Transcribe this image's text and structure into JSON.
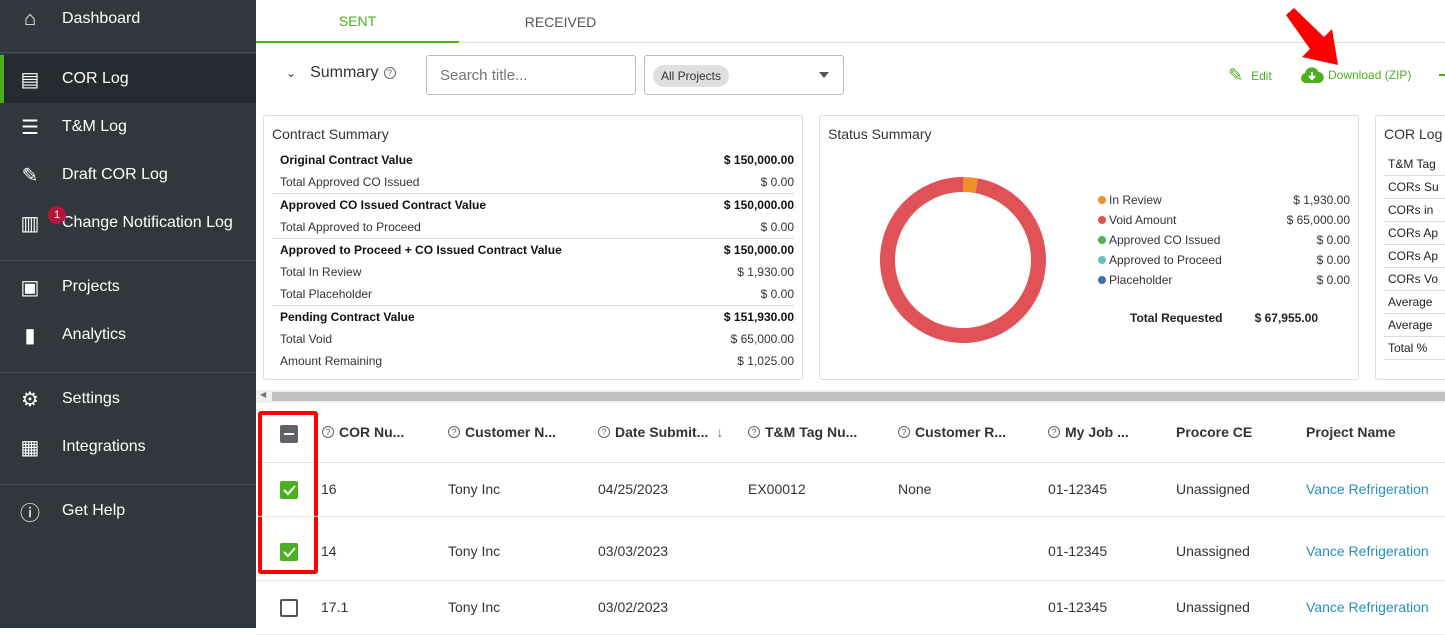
{
  "sidebar": {
    "items": [
      {
        "label": "Dashboard",
        "icon": "home-icon"
      },
      {
        "label": "COR Log",
        "icon": "document-icon",
        "active": true
      },
      {
        "label": "T&M Log",
        "icon": "list-icon"
      },
      {
        "label": "Draft COR Log",
        "icon": "pencil-icon"
      },
      {
        "label": "Change Notification Log",
        "icon": "clipboard-icon",
        "badge": "1"
      },
      {
        "label": "Projects",
        "icon": "briefcase-icon"
      },
      {
        "label": "Analytics",
        "icon": "bar-chart-icon"
      },
      {
        "label": "Settings",
        "icon": "gear-icon"
      },
      {
        "label": "Integrations",
        "icon": "grid-icon"
      },
      {
        "label": "Get Help",
        "icon": "help-icon"
      }
    ]
  },
  "tabs": [
    {
      "label": "SENT",
      "active": true
    },
    {
      "label": "RECEIVED"
    }
  ],
  "toolbar": {
    "summary_label": "Summary",
    "search_placeholder": "Search title...",
    "project_filter": "All Projects",
    "edit_label": "Edit",
    "download_label": "Download (ZIP)"
  },
  "contract_summary": {
    "title": "Contract Summary",
    "rows": [
      {
        "label": "Original Contract Value",
        "value": "$ 150,000.00",
        "bold": true
      },
      {
        "label": "Total Approved CO Issued",
        "value": "$ 0.00"
      },
      {
        "label": "Approved CO Issued Contract Value",
        "value": "$ 150,000.00",
        "bold": true
      },
      {
        "label": "Total Approved to Proceed",
        "value": "$ 0.00"
      },
      {
        "label": "Approved to Proceed + CO Issued Contract Value",
        "value": "$ 150,000.00",
        "bold": true
      },
      {
        "label": "Total In Review",
        "value": "$ 1,930.00"
      },
      {
        "label": "Total Placeholder",
        "value": "$ 0.00"
      },
      {
        "label": "Pending Contract Value",
        "value": "$ 151,930.00",
        "bold": true
      },
      {
        "label": "Total Void",
        "value": "$ 65,000.00"
      },
      {
        "label": "Amount Remaining",
        "value": "$ 1,025.00"
      }
    ]
  },
  "status_summary": {
    "title": "Status Summary",
    "legend": [
      {
        "label": "In Review",
        "value": "$ 1,930.00",
        "amount": 1930,
        "color": "#f0902a"
      },
      {
        "label": "Void Amount",
        "value": "$ 65,000.00",
        "amount": 65000,
        "color": "#e05256"
      },
      {
        "label": "Approved CO Issued",
        "value": "$ 0.00",
        "amount": 0,
        "color": "#4caf50"
      },
      {
        "label": "Approved to Proceed",
        "value": "$ 0.00",
        "amount": 0,
        "color": "#6bbfbf"
      },
      {
        "label": "Placeholder",
        "value": "$ 0.00",
        "amount": 0,
        "color": "#3f6ea8"
      }
    ],
    "total_label": "Total Requested",
    "total_value": "$ 67,955.00"
  },
  "cor_log": {
    "title": "COR Log C",
    "rows": [
      "T&M Tag",
      "CORs Su",
      "CORs in",
      "CORs Ap",
      "CORs Ap",
      "CORs Vo",
      "Average",
      "Average",
      "Total %"
    ]
  },
  "table": {
    "columns": [
      "COR Nu...",
      "Customer N...",
      "Date Submit...",
      "T&M Tag Nu...",
      "Customer R...",
      "My Job ...",
      "Procore CE",
      "Project Name"
    ],
    "rows": [
      {
        "checked": true,
        "cells": [
          "16",
          "Tony Inc",
          "04/25/2023",
          "EX00012",
          "None",
          "01-12345",
          "Unassigned",
          "Vance Refrigeration"
        ]
      },
      {
        "checked": true,
        "cells": [
          "14",
          "Tony Inc",
          "03/03/2023",
          "",
          "",
          "01-12345",
          "Unassigned",
          "Vance Refrigeration"
        ]
      },
      {
        "checked": false,
        "cells": [
          "17.1",
          "Tony Inc",
          "03/02/2023",
          "",
          "",
          "01-12345",
          "Unassigned",
          "Vance Refrigeration"
        ]
      }
    ]
  }
}
